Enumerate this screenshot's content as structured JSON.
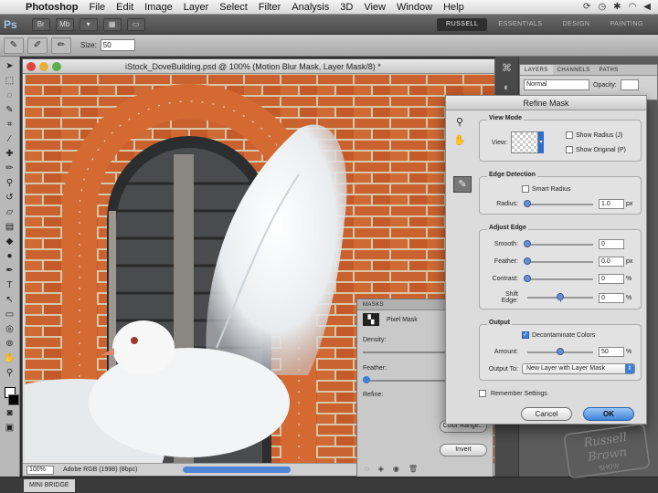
{
  "menubar": {
    "app_name": "Photoshop",
    "items": [
      "File",
      "Edit",
      "Image",
      "Layer",
      "Select",
      "Filter",
      "Analysis",
      "3D",
      "View",
      "Window",
      "Help"
    ]
  },
  "appbar": {
    "logo": "Ps",
    "workspaces": [
      "RUSSELL",
      "ESSENTIALS",
      "DESIGN",
      "PAINTING"
    ]
  },
  "options": {
    "size_label": "Size:",
    "size_value": "50"
  },
  "document": {
    "title": "iStock_DoveBuilding.psd @ 100% (Motion Blur Mask, Layer Mask/8) *",
    "zoom": "100%",
    "doc_info": "Adobe RGB (1998) (8bpc)"
  },
  "layers_panel": {
    "tabs": [
      "LAYERS",
      "CHANNELS",
      "PATHS"
    ],
    "blend_mode": "Normal",
    "opacity_label": "Opacity:"
  },
  "masks_panel": {
    "tab": "MASKS",
    "mask_type": "Pixel Mask",
    "density_label": "Density:",
    "feather_label": "Feather:",
    "refine_label": "Refine:",
    "color_range": "Color Range...",
    "invert": "Invert"
  },
  "refine_mask": {
    "title": "Refine Mask",
    "view_mode": {
      "title": "View Mode",
      "view_label": "View:",
      "show_radius": "Show Radius (J)",
      "show_original": "Show Original (P)"
    },
    "edge_detection": {
      "title": "Edge Detection",
      "smart_radius": "Smart Radius",
      "radius_label": "Radius:",
      "radius_value": "1.0",
      "radius_unit": "px"
    },
    "adjust_edge": {
      "title": "Adjust Edge",
      "smooth_label": "Smooth:",
      "smooth_value": "0",
      "feather_label": "Feather:",
      "feather_value": "0.0",
      "feather_unit": "px",
      "contrast_label": "Contrast:",
      "contrast_value": "0",
      "contrast_unit": "%",
      "shift_label": "Shift Edge:",
      "shift_value": "0",
      "shift_unit": "%"
    },
    "output": {
      "title": "Output",
      "decontaminate": "Decontaminate Colors",
      "amount_label": "Amount:",
      "amount_value": "50",
      "amount_unit": "%",
      "output_to_label": "Output To:",
      "output_to_value": "New Layer with Layer Mask"
    },
    "remember": "Remember Settings",
    "cancel": "Cancel",
    "ok": "OK"
  },
  "bottom": {
    "mini_bridge": "MINI BRIDGE"
  },
  "watermark": {
    "line1": "Russell",
    "line2": "Brown",
    "line3": "SHOW"
  },
  "colors": {
    "brick": "#c8602e",
    "accent_blue": "#3f83d6"
  }
}
